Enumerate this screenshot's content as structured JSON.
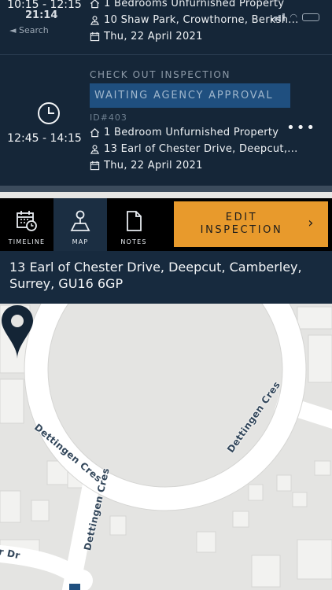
{
  "status_bar": {
    "clock": "21:14",
    "back_label": "◄ Search"
  },
  "inspections": [
    {
      "time": "10:15 - 12:15",
      "property": "1 Bedrooms Unfurnished Property",
      "address": "10 Shaw Park, Crowthorne, Berksh...",
      "date": "Thu, 22 April 2021"
    },
    {
      "type": "CHECK OUT INSPECTION",
      "status": "WAITING AGENCY APPROVAL",
      "id": "ID#403",
      "time": "12:45 - 14:15",
      "property": "1 Bedroom Unfurnished Property",
      "address": "13 Earl of Chester Drive, Deepcut,...",
      "date": "Thu, 22 April 2021",
      "more_icon": "more-dots-icon"
    }
  ],
  "tabs": [
    {
      "label": "TIMELINE",
      "icon": "calendar-clock-icon"
    },
    {
      "label": "MAP",
      "icon": "map-pin-icon",
      "active": true
    },
    {
      "label": "NOTES",
      "icon": "document-icon"
    }
  ],
  "edit_button": {
    "line1": "EDIT",
    "line2": "INSPECTION",
    "chevron": "›"
  },
  "address_bar": {
    "text": "13 Earl of Chester Drive, Deepcut, Camberley, Surrey, GU16 6GP"
  },
  "map": {
    "streets": [
      "Dettingen Cres",
      "Dettingen Cres",
      "Dettingen Cres",
      "r Dr"
    ],
    "pin_icon": "location-pin-icon"
  },
  "colors": {
    "header_bg": "#152638",
    "status_chip": "#1f4f7f",
    "accent": "#e89a2c",
    "tab_active": "#1b2e42",
    "map_bg": "#e4e4e2"
  }
}
